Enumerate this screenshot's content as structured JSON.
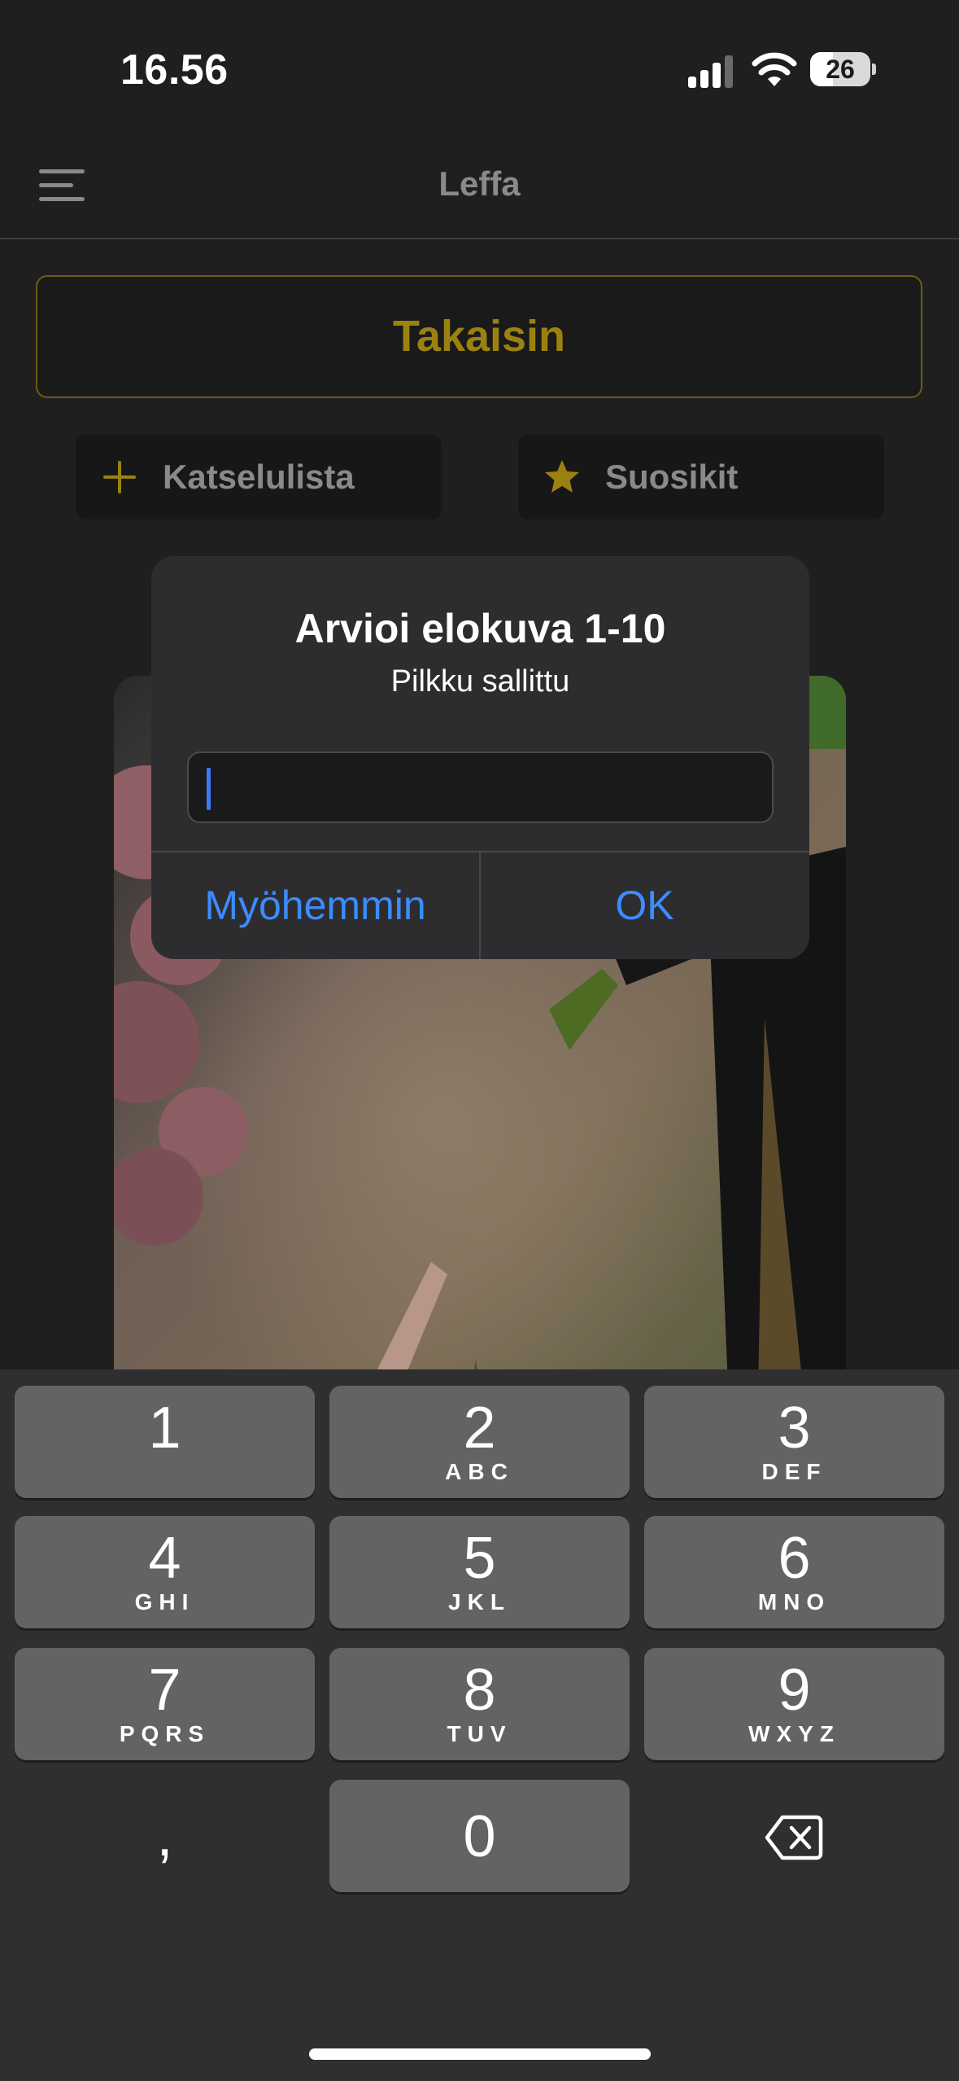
{
  "status_bar": {
    "time": "16.56",
    "battery": "26",
    "icons": [
      "signal-icon",
      "wifi-icon",
      "battery-icon"
    ]
  },
  "header": {
    "title": "Leffa",
    "menu_icon": "hamburger-menu-icon"
  },
  "back_button": {
    "label": "Takaisin"
  },
  "actions": {
    "watchlist": {
      "label": "Katselulista",
      "icon": "plus-icon"
    },
    "favorites": {
      "label": "Suosikit",
      "icon": "star-icon"
    }
  },
  "alert": {
    "title": "Arvioi elokuva 1-10",
    "message": "Pilkku sallittu",
    "input_value": "",
    "buttons": {
      "later": "Myöhemmin",
      "ok": "OK"
    }
  },
  "keypad": {
    "keys": [
      {
        "digit": "1",
        "letters": ""
      },
      {
        "digit": "2",
        "letters": "ABC"
      },
      {
        "digit": "3",
        "letters": "DEF"
      },
      {
        "digit": "4",
        "letters": "GHI"
      },
      {
        "digit": "5",
        "letters": "JKL"
      },
      {
        "digit": "6",
        "letters": "MNO"
      },
      {
        "digit": "7",
        "letters": "PQRS"
      },
      {
        "digit": "8",
        "letters": "TUV"
      },
      {
        "digit": "9",
        "letters": "WXYZ"
      },
      {
        "digit": "0",
        "letters": ""
      }
    ],
    "comma": ",",
    "delete_icon": "backspace-icon"
  },
  "colors": {
    "accent": "#9b8210",
    "link": "#3c8cff",
    "caret": "#3c7bf5"
  }
}
